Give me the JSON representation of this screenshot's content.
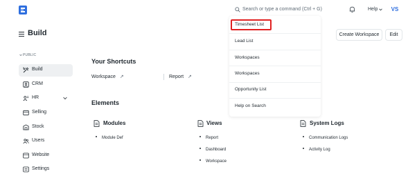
{
  "topbar": {
    "search_placeholder": "Search or type a command (Ctrl + G)",
    "help_label": "Help",
    "avatar_initials": "VS",
    "brand_color": "#2f6fdf"
  },
  "header": {
    "title": "Build",
    "create_workspace_label": "Create Workspace",
    "edit_label": "Edit"
  },
  "sidebar": {
    "section_label": "PUBLIC",
    "items": [
      {
        "label": "Build",
        "icon": "tools-icon",
        "active": true
      },
      {
        "label": "CRM",
        "icon": "crm-icon"
      },
      {
        "label": "HR",
        "icon": "hr-icon",
        "expandable": true
      },
      {
        "label": "Selling",
        "icon": "selling-icon"
      },
      {
        "label": "Stock",
        "icon": "stock-icon"
      },
      {
        "label": "Users",
        "icon": "users-icon"
      },
      {
        "label": "Website",
        "icon": "website-icon"
      },
      {
        "label": "Settings",
        "icon": "settings-icon"
      }
    ]
  },
  "main": {
    "shortcuts_title": "Your Shortcuts",
    "shortcuts": [
      {
        "label": "Workspace",
        "arrow": "↗"
      },
      {
        "label": "Report",
        "arrow": "↗"
      }
    ],
    "elements_title": "Elements",
    "cards": [
      {
        "title": "Modules",
        "links": [
          "Module Def"
        ]
      },
      {
        "title": "Views",
        "links": [
          "Report",
          "Dashboard",
          "Workspace"
        ]
      },
      {
        "title": "System Logs",
        "links": [
          "Communication Logs",
          "Activity Log"
        ]
      }
    ]
  },
  "dropdown": {
    "items": [
      "Timesheet List",
      "Lead List",
      "Workspaces",
      "Workspaces",
      "Opportunity List",
      "Help on Search"
    ],
    "highlight_color": "#e02020"
  }
}
